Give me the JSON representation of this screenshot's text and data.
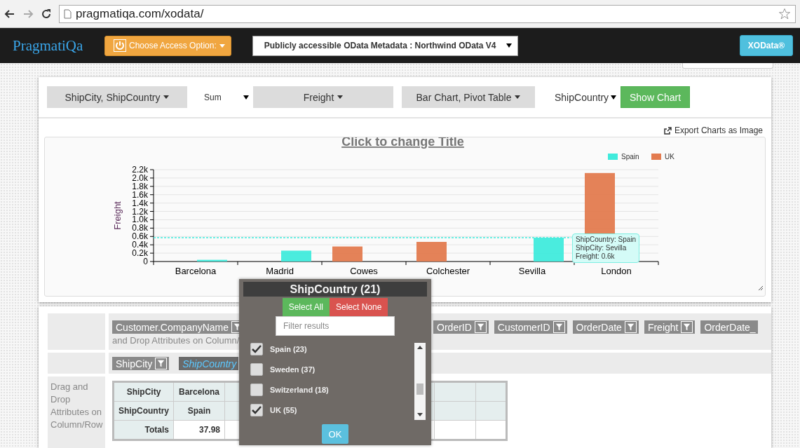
{
  "browser": {
    "url": "pragmatiqa.com/xodata/"
  },
  "navbar": {
    "brand": "PragmatiQa",
    "access_button": "Choose Access Option:",
    "metadata_select": "Publicly accessible OData Metadata : Northwind OData V4",
    "product_button": "XOData®"
  },
  "toolbar": [
    {
      "kind": "dropdown",
      "label": "ShipCity, ShipCountry"
    },
    {
      "kind": "select",
      "label": "Sum"
    },
    {
      "kind": "dropdown",
      "label": "Freight"
    },
    {
      "kind": "dropdown",
      "label": "Bar Chart, Pivot Table"
    },
    {
      "kind": "select",
      "label": "ShipCountry"
    },
    {
      "kind": "button",
      "label": "Show Chart"
    }
  ],
  "export_link": "Export Charts as Image",
  "chart": {
    "chart_data": {
      "type": "bar",
      "title": "Click to change Title",
      "ylabel": "Freight",
      "categories": [
        "Barcelona",
        "Madrid",
        "Cowes",
        "Colchester",
        "Sevilla",
        "London"
      ],
      "series": [
        {
          "name": "Spain",
          "color": "#40ebdc",
          "values": [
            40,
            260,
            null,
            null,
            570,
            null
          ]
        },
        {
          "name": "UK",
          "color": "#e37b4f",
          "values": [
            null,
            null,
            360,
            470,
            null,
            2120
          ]
        }
      ],
      "grid": true,
      "legend": true,
      "ref_lines": [
        {
          "axis": "y",
          "value": 570,
          "color": "#40ebdc"
        }
      ],
      "ylim": [
        0,
        2200
      ],
      "yticks": [
        0,
        {
          "value": 200,
          "label": "0.2k"
        },
        {
          "value": 400,
          "label": "0.4k"
        },
        {
          "value": 600,
          "label": "0.6k"
        },
        {
          "value": 800,
          "label": "0.8k"
        },
        {
          "value": 1000,
          "label": "1.0k"
        },
        {
          "value": 1200,
          "label": "1.2k"
        },
        {
          "value": 1400,
          "label": "1.4k"
        },
        {
          "value": 1600,
          "label": "1.6k"
        },
        {
          "value": 1800,
          "label": "1.8k"
        },
        {
          "value": 2000,
          "label": "2.0k"
        },
        {
          "value": 2200,
          "label": "2.2k"
        }
      ],
      "annotations": [
        {
          "x": "Sevilla",
          "text": [
            "ShipCountry: Spain",
            "ShipCity: Sevilla",
            "Freight: 0.6k"
          ]
        }
      ]
    }
  },
  "pivot": {
    "column_attributes": [
      {
        "label": "Customer.CompanyName"
      },
      {
        "label": "OrderID"
      },
      {
        "label": "CustomerID"
      },
      {
        "label": "OrderDate"
      },
      {
        "label": "Freight"
      },
      {
        "label": "OrderDate_"
      }
    ],
    "column_hint": "and Drop Attributes on Column/",
    "row_attributes": [
      {
        "label": "ShipCity",
        "dragging": false
      },
      {
        "label": "ShipCountry",
        "dragging": true
      }
    ],
    "side_hint": "Drag and Drop Attributes on Column/Row",
    "table": [
      [
        "ShipCity",
        "Barcelona"
      ],
      [
        "ShipCountry",
        "Spain"
      ],
      [
        "Totals",
        "37.98"
      ]
    ]
  },
  "filter_popup": {
    "title": "ShipCountry (21)",
    "select_all": "Select All",
    "select_none": "Select None",
    "filter": {
      "placeholder": "Filter results"
    },
    "items": [
      {
        "label": "Spain (23)",
        "checked": true
      },
      {
        "label": "Sweden (37)",
        "checked": false
      },
      {
        "label": "Switzerland (18)",
        "checked": false
      },
      {
        "label": "UK (55)",
        "checked": true
      }
    ],
    "ok": "OK"
  }
}
